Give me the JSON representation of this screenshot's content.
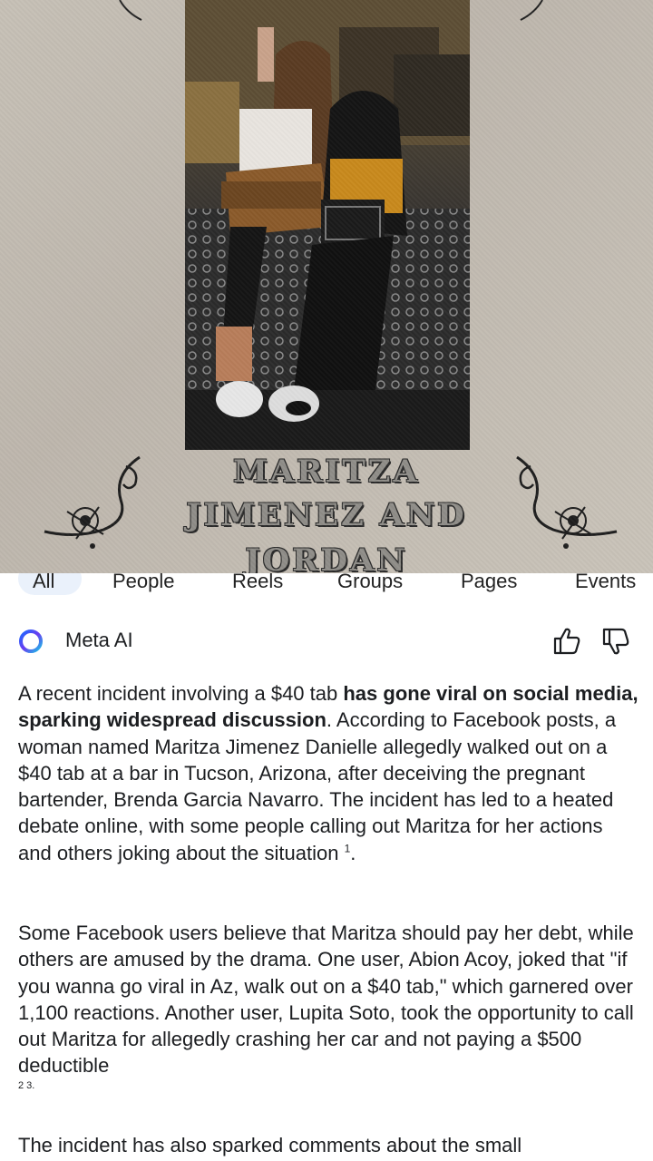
{
  "poster": {
    "title_line1": "MARITZA",
    "title_line2": "JIMENEZ AND",
    "title_line3": "JORDAN"
  },
  "tabs": [
    "All",
    "People",
    "Reels",
    "Groups",
    "Pages",
    "Events"
  ],
  "meta_ai": {
    "name": "Meta AI",
    "icons": [
      "meta-ai-logo-icon",
      "thumbs-up-icon",
      "thumbs-down-icon"
    ]
  },
  "answer": {
    "p1_a": "A recent incident involving a $40 tab ",
    "p1_bold": "has gone viral on social media, sparking widespread discussion",
    "p1_b": ". According to Facebook posts, a woman named Maritza Jimenez Danielle allegedly walked out on a $40 tab at a bar in Tucson, Arizona, after deceiving the pregnant bartender, Brenda Garcia Navarro. The incident has led to a heated debate online, with some people calling out Maritza for her actions and others joking about the situation ",
    "p1_cite": "1",
    "p1_end": ".",
    "p2": "Some Facebook users believe that Maritza should pay her debt, while others are amused by the drama. One user, Abion Acoy, joked that \"if you wanna go viral in Az, walk out on a $40 tab,\" which garnered over 1,100 reactions. Another user, Lupita Soto, took the opportunity to call out Maritza for allegedly crashing her car and not paying a $500 deductible",
    "p2_cite": "2 3",
    "p2_end": ".",
    "p3": "The incident has also sparked comments about the small"
  },
  "colors": {
    "poster_bg": "#c6c0b6",
    "text": "#1c1e21",
    "tab_highlight": "#eaf1fb"
  }
}
